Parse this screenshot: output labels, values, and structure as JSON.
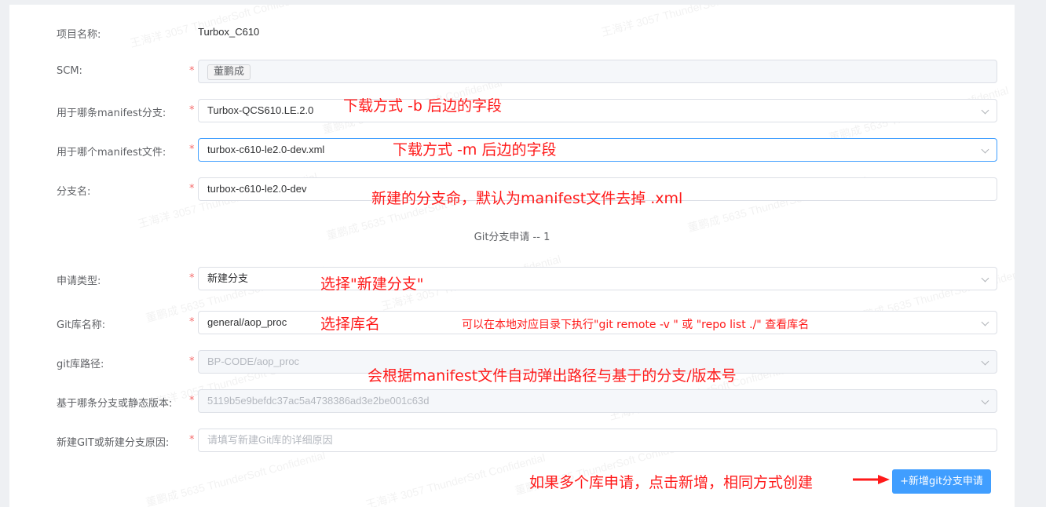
{
  "project": {
    "label": "项目名称:",
    "value": "Turbox_C610"
  },
  "scm": {
    "label": "SCM:",
    "required": "*",
    "tag": "董鹏成"
  },
  "manifest_branch": {
    "label": "用于哪条manifest分支:",
    "required": "*",
    "value": "Turbox-QCS610.LE.2.0",
    "icon": "chevron-down-icon"
  },
  "manifest_file": {
    "label": "用于哪个manifest文件:",
    "required": "*",
    "value": "turbox-c610-le2.0-dev.xml",
    "icon": "chevron-down-icon"
  },
  "branch_name": {
    "label": "分支名:",
    "required": "*",
    "value": "turbox-c610-le2.0-dev"
  },
  "section_title": "Git分支申请 -- 1",
  "apply_type": {
    "label": "申请类型:",
    "required": "*",
    "value": "新建分支",
    "icon": "chevron-down-icon"
  },
  "git_repo_name": {
    "label": "Git库名称:",
    "required": "*",
    "value": "general/aop_proc",
    "icon": "chevron-down-icon"
  },
  "git_repo_path": {
    "label": "git库路径:",
    "required": "*",
    "value": "BP-CODE/aop_proc",
    "icon": "chevron-down-icon"
  },
  "base_version": {
    "label": "基于哪条分支或静态版本:",
    "required": "*",
    "value": "5119b5e9befdc37ac5a4738386ad3e2be001c63d",
    "icon": "chevron-down-icon"
  },
  "reason": {
    "label": "新建GIT或新建分支原因:",
    "required": "*",
    "placeholder": "请填写新建Git库的详细原因"
  },
  "add_button": {
    "label": "+新增git分支申请"
  },
  "annotations": {
    "a1": "下载方式 -b 后边的字段",
    "a2": "下载方式 -m 后边的字段",
    "a3": "新建的分支命，默认为manifest文件去掉 .xml",
    "a4": "选择\"新建分支\"",
    "a5": "选择库名",
    "a6": "可以在本地对应目录下执行\"git remote -v \" 或 \"repo list ./\" 查看库名",
    "a7": "会根据manifest文件自动弹出路径与基于的分支/版本号",
    "a8": "如果多个库申请，点击新增，相同方式创建"
  },
  "watermarks": {
    "w1": "王海洋 3057 ThunderSoft Confidential",
    "w2": "董鹏成 5635 ThunderSoft Confidential"
  },
  "colors": {
    "accent": "#409eff",
    "required": "#f56c6c",
    "annotation": "#ff1a1a"
  }
}
